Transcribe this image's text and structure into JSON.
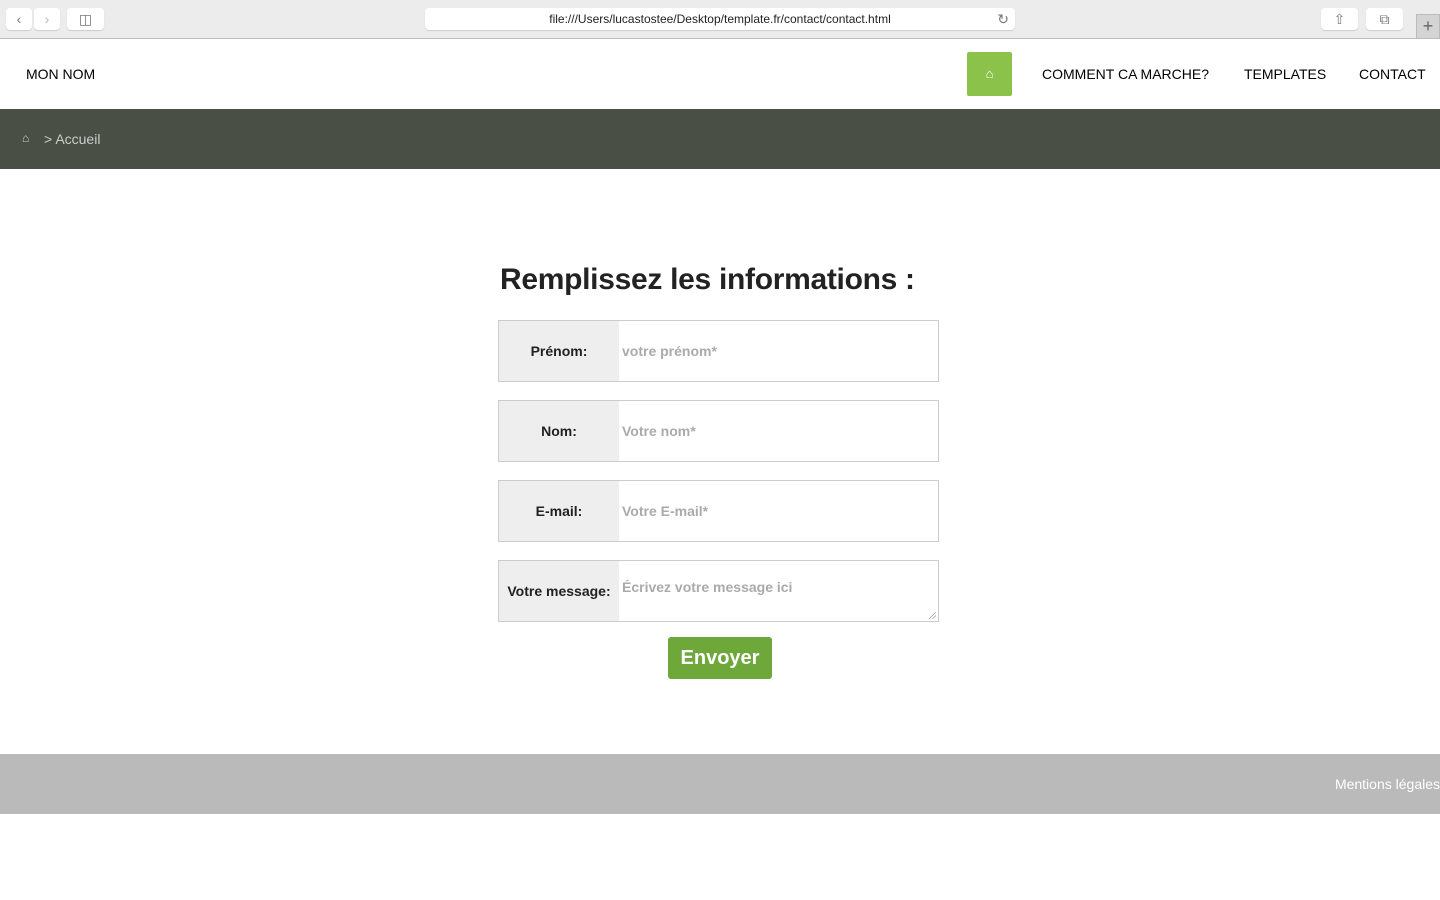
{
  "browser": {
    "url": "file:///Users/lucastostee/Desktop/template.fr/contact/contact.html"
  },
  "header": {
    "brand": "MON NOM",
    "nav": [
      "COMMENT CA MARCHE?",
      "TEMPLATES",
      "CONTACT"
    ],
    "accent": "#8bc34a"
  },
  "breadcrumb": {
    "separator": ">",
    "current": "Accueil"
  },
  "form": {
    "title": "Remplissez les informations :",
    "fields": [
      {
        "label": "Prénom:",
        "placeholder": "votre prénom*"
      },
      {
        "label": "Nom:",
        "placeholder": "Votre nom*"
      },
      {
        "label": "E-mail:",
        "placeholder": "Votre E-mail*"
      },
      {
        "label": "Votre message:",
        "placeholder": "Écrivez votre message ici"
      }
    ],
    "submit": "Envoyer"
  },
  "footer": {
    "link": "Mentions légales"
  }
}
